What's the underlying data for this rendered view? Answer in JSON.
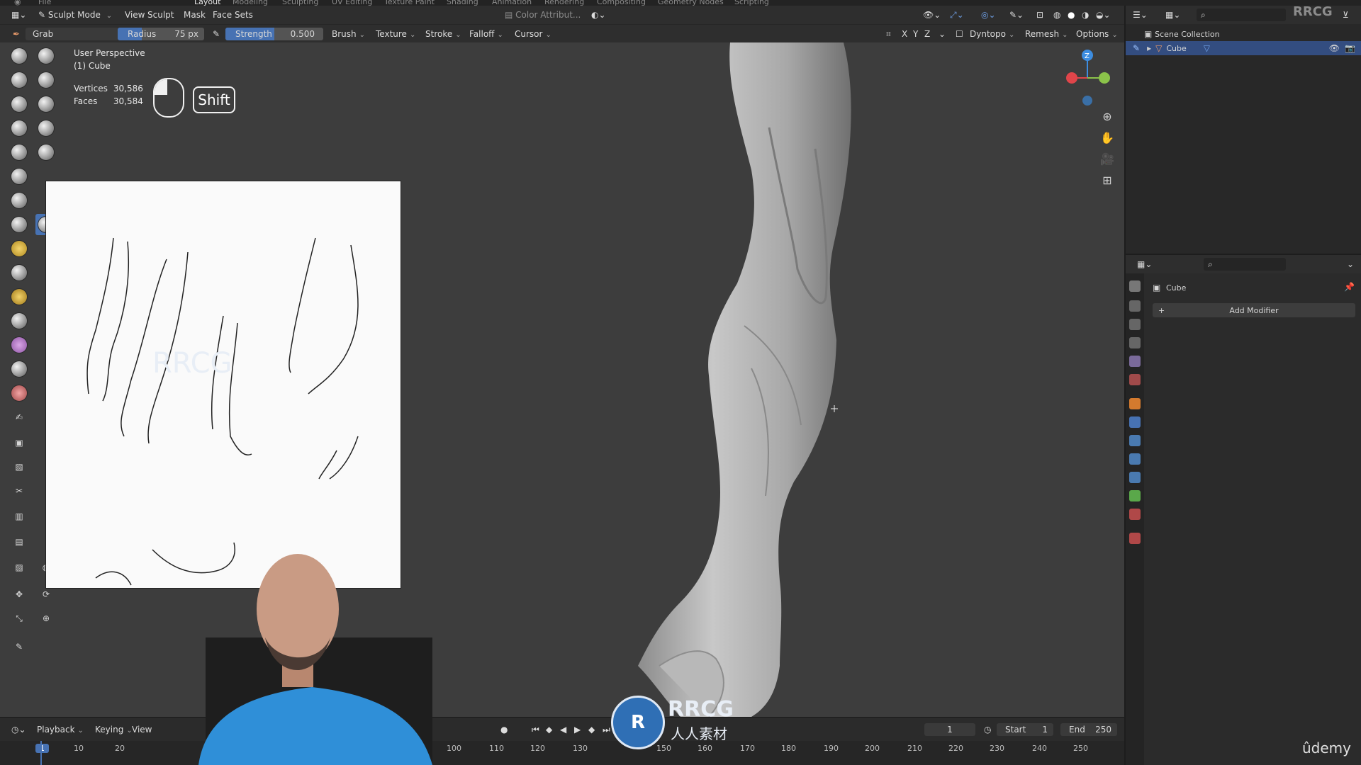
{
  "top_tabs": [
    "Layout",
    "Modeling",
    "Sculpting",
    "UV Editing",
    "Texture Paint",
    "Shading",
    "Animation",
    "Rendering",
    "Compositing",
    "Geometry Nodes",
    "Scripting"
  ],
  "header": {
    "mode": "Sculpt Mode",
    "menus": [
      "View",
      "Sculpt",
      "Mask",
      "Face Sets"
    ],
    "color_attribute": "Color Attribut...",
    "brush_name": "Grab",
    "radius_label": "Radius",
    "radius_value": "75 px",
    "strength_label": "Strength",
    "strength_value": "0.500",
    "dropdowns": [
      "Brush",
      "Texture",
      "Stroke",
      "Falloff",
      "Cursor"
    ],
    "axes": [
      "X",
      "Y",
      "Z"
    ],
    "dyntopo": "Dyntopo",
    "remesh": "Remesh",
    "options": "Options"
  },
  "viewport": {
    "perspective": "User Perspective",
    "object": "(1) Cube",
    "vertices_label": "Vertices",
    "vertices_value": "30,586",
    "faces_label": "Faces",
    "faces_value": "30,584",
    "key_hint": "Shift",
    "gizmo_axis": "Z"
  },
  "outliner": {
    "root": "Scene Collection",
    "item": "Cube"
  },
  "properties": {
    "object_name": "Cube",
    "add_modifier": "Add Modifier"
  },
  "timeline": {
    "menus": [
      "Playback",
      "Keying",
      "View"
    ],
    "current_frame": "1",
    "start_label": "Start",
    "start_value": "1",
    "end_label": "End",
    "end_value": "250",
    "ruler_marks": [
      "1",
      "10",
      "20",
      "100",
      "110",
      "120",
      "130",
      "150",
      "160",
      "170",
      "180",
      "190",
      "200",
      "210",
      "220",
      "230",
      "240",
      "250"
    ]
  },
  "overlays": {
    "watermark_text": "RRCG",
    "watermark_sub": "人人素材",
    "top_right_tag": "RRCG",
    "brand": "ûdemy"
  },
  "colors": {
    "accent": "#4772b3",
    "viewport_bg": "#3d3d3d",
    "panel_bg": "#2b2b2b",
    "axis_x": "#e0454a",
    "axis_y": "#8bc34a",
    "axis_z": "#3d8de0"
  }
}
